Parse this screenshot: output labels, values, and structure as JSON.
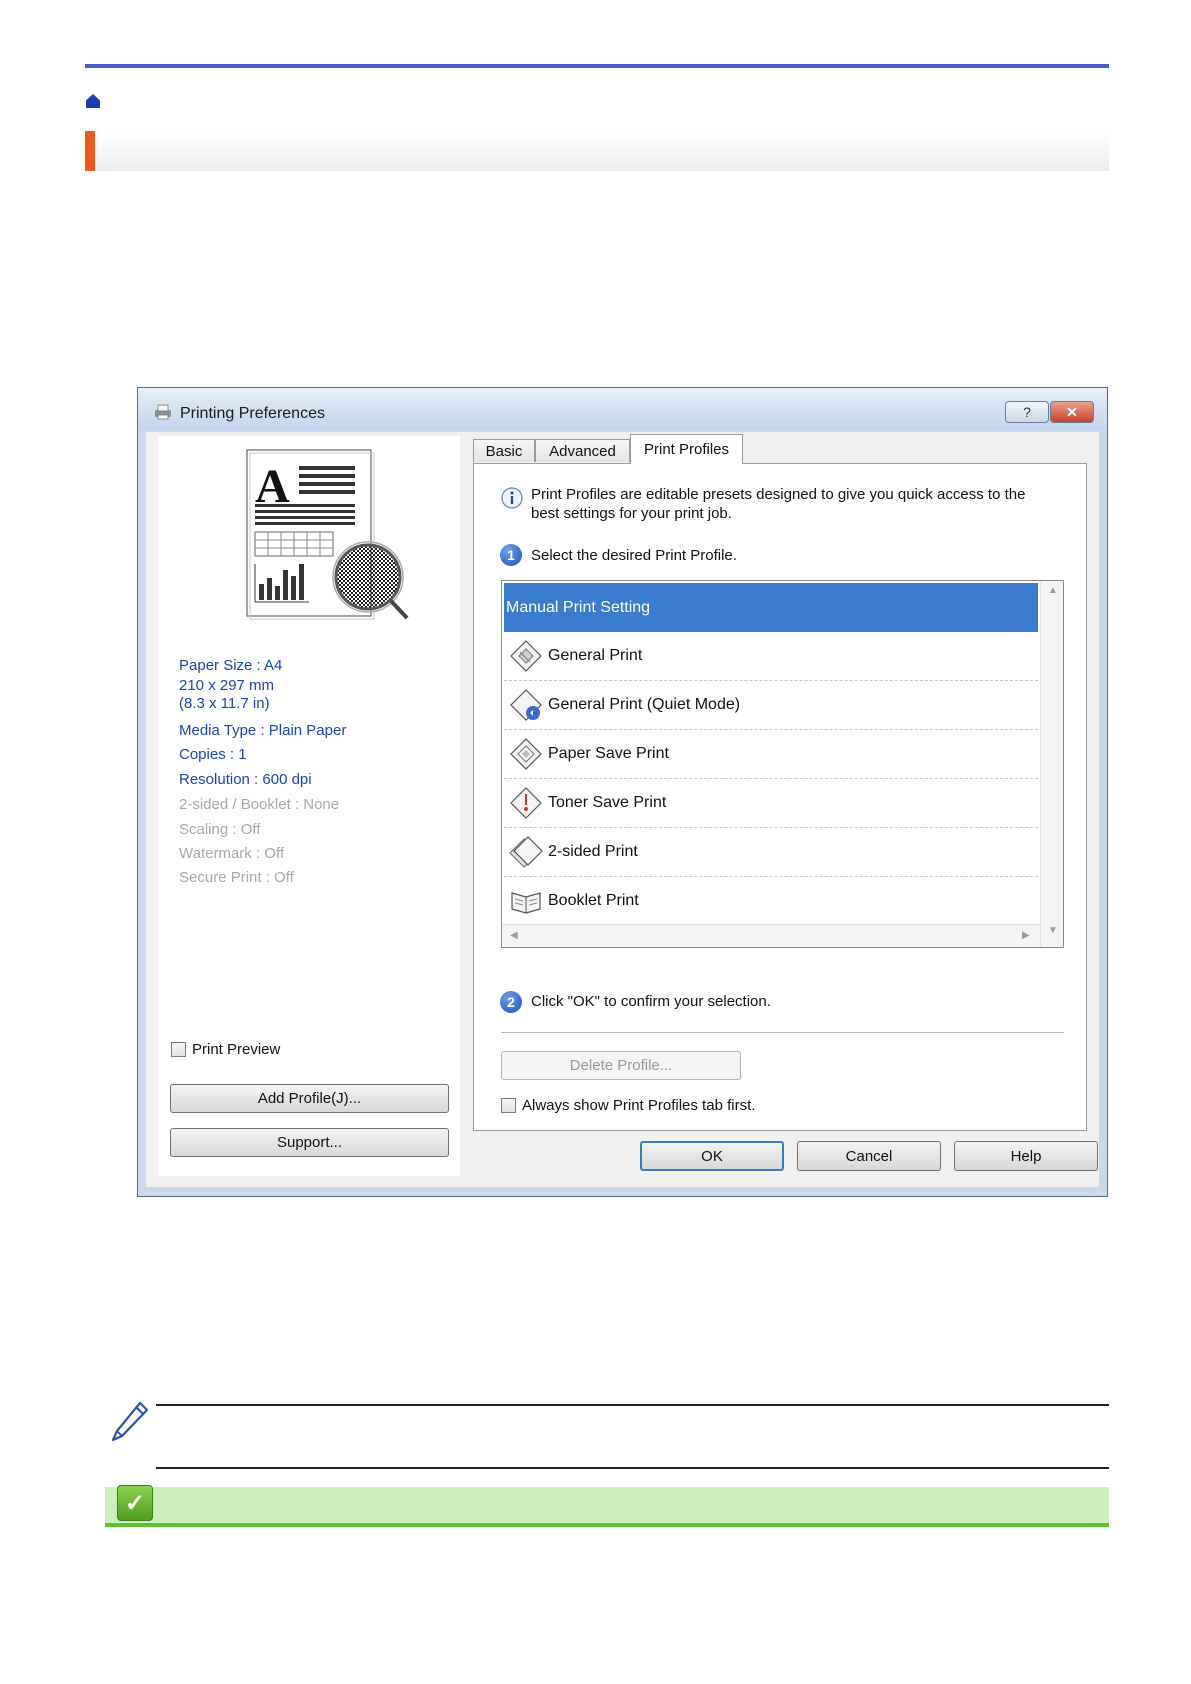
{
  "dialog": {
    "title": "Printing Preferences",
    "help_btn": "?",
    "close_btn": "✕"
  },
  "left_panel": {
    "settings": [
      {
        "text": "Paper Size : A4",
        "enabled": true
      },
      {
        "text": "210 x 297 mm",
        "enabled": true
      },
      {
        "text": "(8.3 x 11.7 in)",
        "enabled": true
      },
      {
        "text": "Media Type : Plain Paper",
        "enabled": true
      },
      {
        "text": "Copies : 1",
        "enabled": true
      },
      {
        "text": "Resolution : 600 dpi",
        "enabled": true
      },
      {
        "text": "2-sided / Booklet : None",
        "enabled": false
      },
      {
        "text": "Scaling : Off",
        "enabled": false
      },
      {
        "text": "Watermark : Off",
        "enabled": false
      },
      {
        "text": "Secure Print : Off",
        "enabled": false
      }
    ],
    "print_preview_label": "Print Preview",
    "add_profile_label": "Add Profile(J)...",
    "support_label": "Support..."
  },
  "tabs": [
    {
      "label": "Basic",
      "active": false
    },
    {
      "label": "Advanced",
      "active": false
    },
    {
      "label": "Print Profiles",
      "active": true
    }
  ],
  "profiles_tab": {
    "info_text_line1": "Print Profiles are editable presets designed to give you quick access to the",
    "info_text_line2": "best settings for your print job.",
    "step1_number": "1",
    "step1_text": "Select the desired Print Profile.",
    "profiles": [
      {
        "label": "Manual Print Setting",
        "selected": true
      },
      {
        "label": "General Print",
        "selected": false
      },
      {
        "label": "General Print (Quiet Mode)",
        "selected": false
      },
      {
        "label": "Paper Save Print",
        "selected": false
      },
      {
        "label": "Toner Save Print",
        "selected": false
      },
      {
        "label": "2-sided Print",
        "selected": false
      },
      {
        "label": "Booklet Print",
        "selected": false
      }
    ],
    "step2_number": "2",
    "step2_text": "Click \"OK\" to confirm your selection.",
    "delete_profile_label": "Delete Profile...",
    "always_show_label": "Always show Print Profiles tab first."
  },
  "footer_buttons": {
    "ok": "OK",
    "cancel": "Cancel",
    "help": "Help"
  },
  "colors": {
    "top_rule": "#4a5ec8",
    "title_accent": "#ee5a1c",
    "selection": "#3a7bd0",
    "enabled_setting_text": "#1a44b8",
    "check_bar": "#cfeec0",
    "check_bar_line": "#5cc133"
  }
}
